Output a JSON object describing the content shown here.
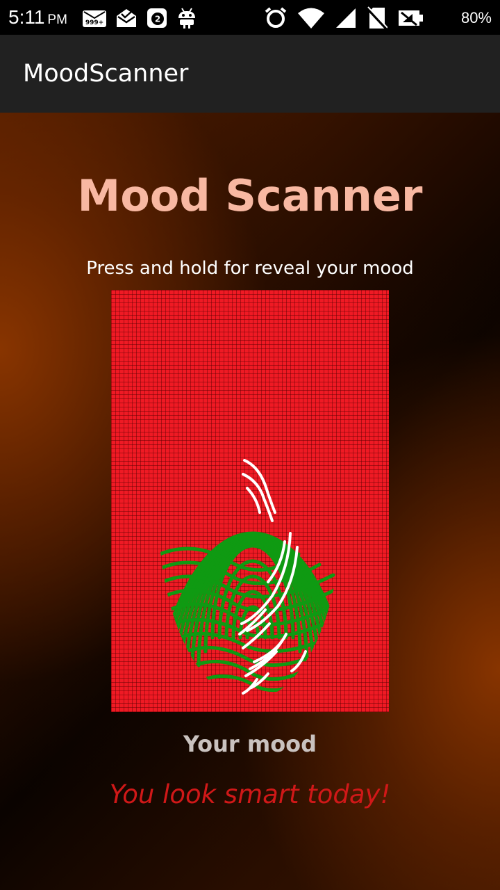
{
  "status_bar": {
    "time": "5:11",
    "period": "PM",
    "notification_icons": [
      "email-999-icon",
      "mail-icon",
      "sync-badge-icon",
      "android-icon"
    ],
    "notification_badges": {
      "email": "999+",
      "sync": "2"
    },
    "system_icons": [
      "alarm-icon",
      "wifi-icon",
      "cell-signal-icon",
      "no-sim-icon",
      "data-off-icon",
      "battery-icon"
    ],
    "battery": "80%"
  },
  "app_bar": {
    "title": "MoodScanner"
  },
  "main": {
    "heading": "Mood Scanner",
    "instruction": "Press and hold for reveal your mood",
    "scanner": {
      "icon": "fingerprint-icon",
      "grid_color": "#ef1a24",
      "print_color": "#0f9a12",
      "highlight_color": "#ffffff"
    },
    "mood_label": "Your mood",
    "mood_result": "You look smart today!"
  },
  "colors": {
    "heading": "#f8b8a2",
    "mood_result": "#d01818",
    "app_bar": "#212121",
    "background_glow": "#8c3600"
  }
}
